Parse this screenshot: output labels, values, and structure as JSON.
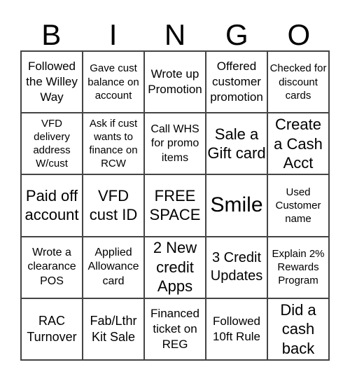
{
  "header": [
    "B",
    "I",
    "N",
    "G",
    "O"
  ],
  "cells": [
    "Followed the Willey Way",
    "Gave cust balance on account",
    "Wrote up Promotion",
    "Offered customer promotion",
    "Checked for discount cards",
    "VFD delivery address W/cust",
    "Ask if cust wants to finance on RCW",
    "Call WHS for promo items",
    "Sale a Gift card",
    "Create a Cash Acct",
    "Paid off account",
    "VFD cust ID",
    "FREE SPACE",
    "Smile",
    "Used Customer name",
    "Wrote a clearance POS",
    "Applied Allowance card",
    "2 New credit Apps",
    "3 Credit Updates",
    "Explain 2% Rewards Program",
    "RAC Turnover",
    "Fab/Lthr Kit Sale",
    "Financed ticket on REG",
    "Followed 10ft Rule",
    "Did a cash back"
  ]
}
